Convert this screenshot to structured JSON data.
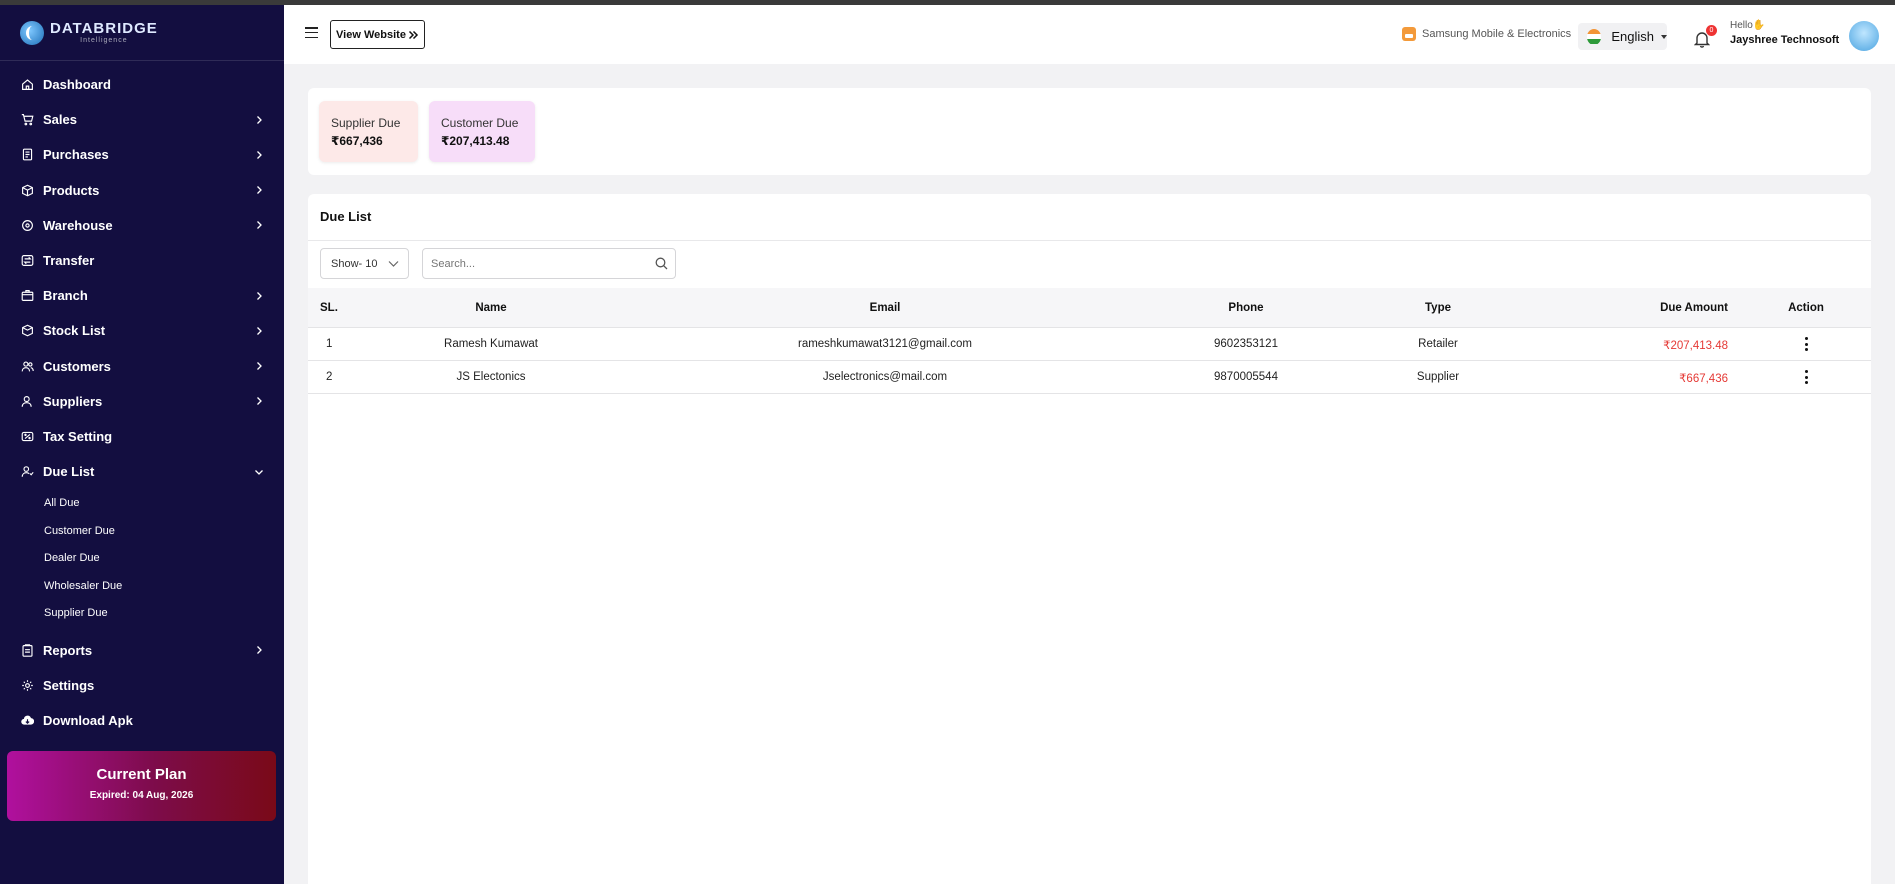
{
  "brand": {
    "title": "DATABRIDGE",
    "subtitle": "Intelligence"
  },
  "sidebar": {
    "items": [
      {
        "label": "Dashboard",
        "icon": "home-icon"
      },
      {
        "label": "Sales",
        "icon": "cart-icon"
      },
      {
        "label": "Purchases",
        "icon": "receipt-icon"
      },
      {
        "label": "Products",
        "icon": "box-icon"
      },
      {
        "label": "Warehouse",
        "icon": "warehouse-icon"
      },
      {
        "label": "Transfer",
        "icon": "transfer-icon"
      },
      {
        "label": "Branch",
        "icon": "branch-icon"
      },
      {
        "label": "Stock List",
        "icon": "stock-icon"
      },
      {
        "label": "Customers",
        "icon": "users-icon"
      },
      {
        "label": "Suppliers",
        "icon": "supplier-icon"
      },
      {
        "label": "Tax Setting",
        "icon": "tax-icon"
      },
      {
        "label": "Due List",
        "icon": "due-icon"
      },
      {
        "label": "Reports",
        "icon": "reports-icon"
      },
      {
        "label": "Settings",
        "icon": "gear-icon"
      },
      {
        "label": "Download Apk",
        "icon": "cloud-download-icon"
      }
    ],
    "due_sub": [
      "All Due",
      "Customer Due",
      "Dealer Due",
      "Wholesaler Due",
      "Supplier Due"
    ]
  },
  "plan": {
    "title": "Current Plan",
    "expiry": "Expired: 04 Aug, 2026"
  },
  "header": {
    "view_website": "View Website",
    "store": "Samsung Mobile & Electronics",
    "language": "English",
    "notification_count": "0",
    "hello": "Hello",
    "user_name": "Jayshree Technosoft"
  },
  "summary": {
    "supplier_due_label": "Supplier Due",
    "supplier_due_value": "₹667,436",
    "customer_due_label": "Customer Due",
    "customer_due_value": "₹207,413.48"
  },
  "due_list": {
    "title": "Due List",
    "show_label": "Show- 10",
    "search_placeholder": "Search...",
    "columns": [
      "SL.",
      "Name",
      "Email",
      "Phone",
      "Type",
      "Due Amount",
      "Action"
    ],
    "rows": [
      {
        "sl": "1",
        "name": "Ramesh Kumawat",
        "email": "rameshkumawat3121@gmail.com",
        "phone": "9602353121",
        "type": "Retailer",
        "due": "₹207,413.48"
      },
      {
        "sl": "2",
        "name": "JS Electonics",
        "email": "Jselectronics@mail.com",
        "phone": "9870005544",
        "type": "Supplier",
        "due": "₹667,436"
      }
    ]
  },
  "colors": {
    "sidebar_bg": "#130e40",
    "due_red": "#e53935"
  }
}
